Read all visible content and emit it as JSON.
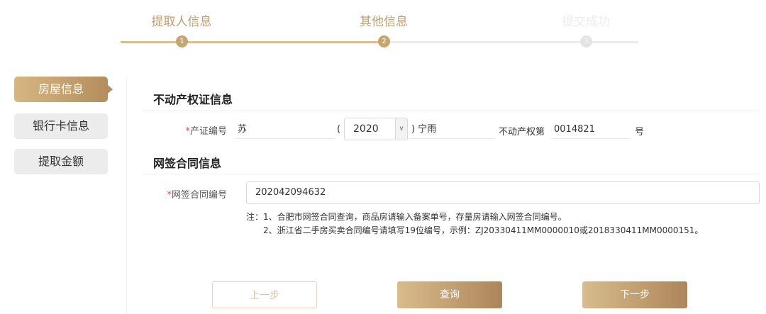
{
  "stepper": {
    "steps": [
      {
        "label": "提取人信息",
        "number": "1",
        "state": "done"
      },
      {
        "label": "其他信息",
        "number": "2",
        "state": "current"
      },
      {
        "label": "提交成功",
        "number": "3",
        "state": "pending"
      }
    ]
  },
  "sidenav": {
    "items": [
      {
        "label": "房屋信息",
        "active": true
      },
      {
        "label": "银行卡信息",
        "active": false
      },
      {
        "label": "提取金额",
        "active": false
      }
    ]
  },
  "property_cert": {
    "title": "不动产权证信息",
    "required_mark": "*",
    "label": "产证编号",
    "province_value": "苏",
    "open_paren": "(",
    "year_value": "2020",
    "close_paren_city": ") 宁雨",
    "rights_prefix": "不动产权第",
    "number_value": "0014821",
    "suffix": "号"
  },
  "contract": {
    "title": "网签合同信息",
    "required_mark": "*",
    "label": "网签合同编号",
    "value": "202042094632",
    "notes": [
      "注：1、合肥市网签合同查询，商品房请输入备案单号，存量房请输入网签合同编号。",
      "2、浙江省二手房买卖合同编号请填写19位编号，示例：ZJ20330411MM0000010或2018330411MM0000151。"
    ]
  },
  "actions": {
    "prev_label": "上一步",
    "query_label": "查询",
    "next_label": "下一步"
  },
  "colors": {
    "accent": "#c7a56f",
    "accent_dark": "#ad865a",
    "required": "#d9534f"
  }
}
